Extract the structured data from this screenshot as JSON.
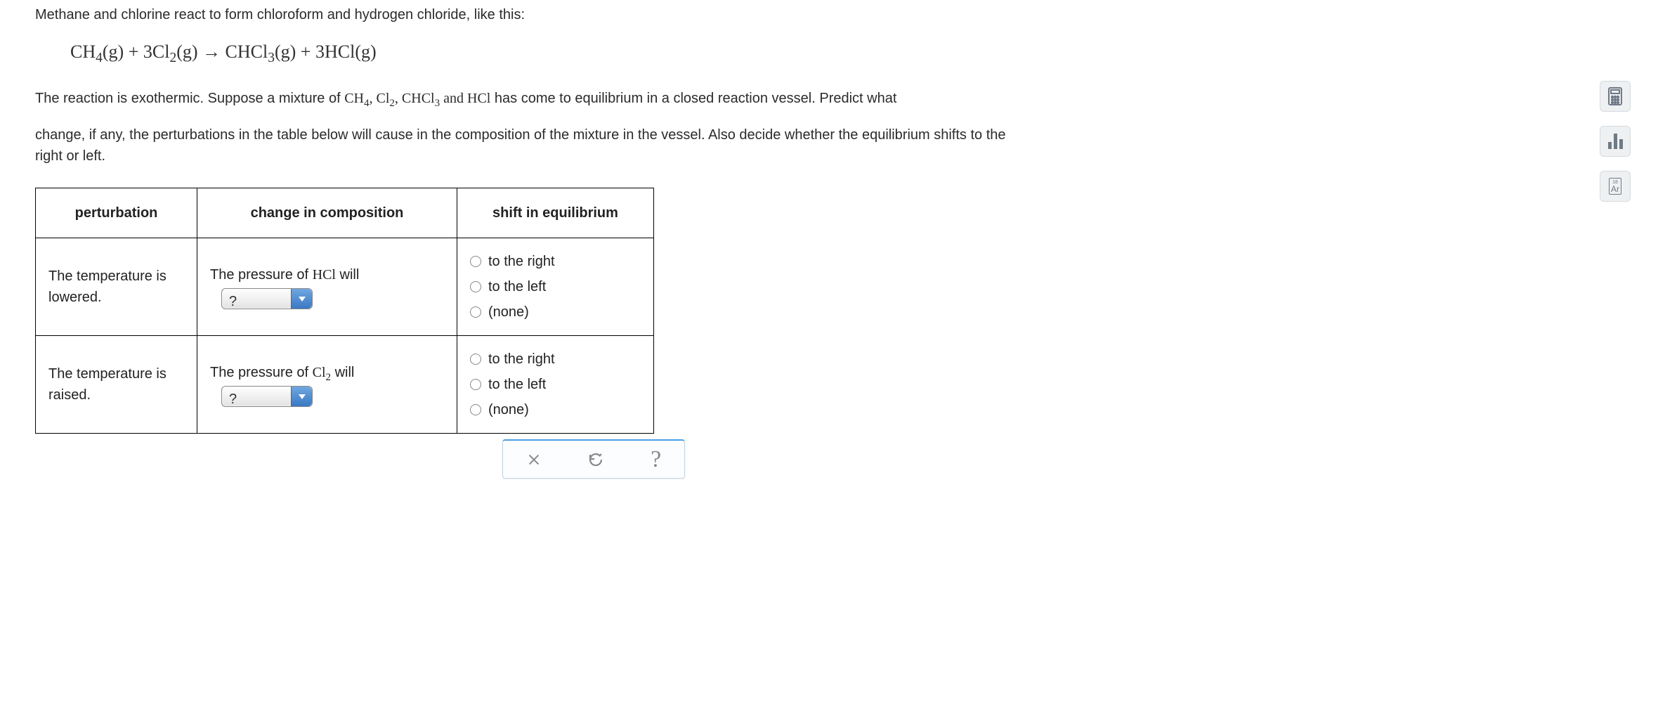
{
  "intro_line": "Methane and chlorine react to form chloroform and hydrogen chloride, like this:",
  "equation": {
    "lhs_a": "CH",
    "lhs_a_sub": "4",
    "lhs_a_phase": "(g)",
    "plus1": "+",
    "lhs_b_coef": "3",
    "lhs_b": "Cl",
    "lhs_b_sub": "2",
    "lhs_b_phase": "(g)",
    "arrow": "→",
    "rhs_a": "CHCl",
    "rhs_a_sub": "3",
    "rhs_a_phase": "(g)",
    "plus2": "+",
    "rhs_b_coef": "3",
    "rhs_b": "HCl",
    "rhs_b_phase": "(g)"
  },
  "para_a_pre": "The reaction is exothermic. Suppose a mixture of ",
  "para_a_species": {
    "s1": "CH",
    "s1s": "4",
    "c1": ", ",
    "s2": "Cl",
    "s2s": "2",
    "c2": ", ",
    "s3": "CHCl",
    "s3s": "3",
    "c3": " and ",
    "s4": "HCl"
  },
  "para_a_post": " has come to equilibrium in a closed reaction vessel. Predict what",
  "para_b": "change, if any, the perturbations in the table below will cause in the composition of the mixture in the vessel. Also decide whether the equilibrium shifts to the right or left.",
  "table": {
    "headers": {
      "pert": "perturbation",
      "change": "change in composition",
      "shift": "shift in equilibrium"
    },
    "rows": [
      {
        "perturbation": "The temperature is lowered.",
        "change_label_pre": "The pressure of ",
        "change_species": "HCl",
        "change_species_sub": "",
        "change_label_post": " will",
        "dropdown": "?",
        "options": [
          "to the right",
          "to the left",
          "(none)"
        ]
      },
      {
        "perturbation": "The temperature is raised.",
        "change_label_pre": "The pressure of ",
        "change_species": "Cl",
        "change_species_sub": "2",
        "change_label_post": " will",
        "dropdown": "?",
        "options": [
          "to the right",
          "to the left",
          "(none)"
        ]
      }
    ]
  },
  "tool_rail": {
    "calc": "calculator-icon",
    "chart": "bar-chart-icon",
    "ar": "Ar",
    "ar_mass": "18"
  }
}
